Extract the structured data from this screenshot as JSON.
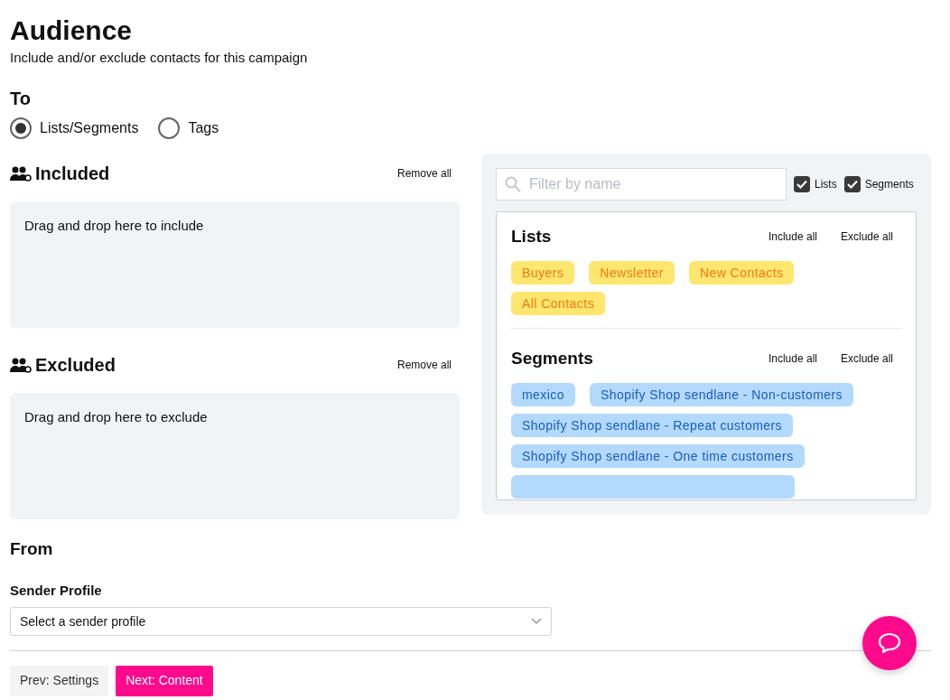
{
  "header": {
    "title": "Audience",
    "subtitle": "Include and/or exclude contacts for this campaign"
  },
  "to": {
    "heading": "To",
    "options": [
      {
        "label": "Lists/Segments",
        "selected": true
      },
      {
        "label": "Tags",
        "selected": false
      }
    ]
  },
  "zones": [
    {
      "title": "Included",
      "action": "Remove all",
      "hint": "Drag and drop here to include"
    },
    {
      "title": "Excluded",
      "action": "Remove all",
      "hint": "Drag and drop here to exclude"
    }
  ],
  "picker": {
    "search": {
      "placeholder": "Filter by name"
    },
    "filters": [
      {
        "label": "Lists",
        "checked": true
      },
      {
        "label": "Segments",
        "checked": true
      }
    ],
    "groups": [
      {
        "kind": "list",
        "title": "Lists",
        "include": "Include all",
        "exclude": "Exclude all",
        "items": [
          "Buyers",
          "Newsletter",
          "New Contacts",
          "All Contacts"
        ]
      },
      {
        "kind": "segment",
        "title": "Segments",
        "include": "Include all",
        "exclude": "Exclude all",
        "items": [
          "mexico",
          "Shopify Shop sendlane - Non-customers",
          "Shopify Shop sendlane - Repeat customers",
          "Shopify Shop sendlane - One time customers"
        ]
      }
    ]
  },
  "from": {
    "heading": "From",
    "label": "Sender Profile",
    "placeholder": "Select a sender profile"
  },
  "buttons": [
    {
      "kind": "secondary",
      "label": "Prev: Settings"
    },
    {
      "kind": "primary",
      "label": "Next: Content"
    }
  ]
}
